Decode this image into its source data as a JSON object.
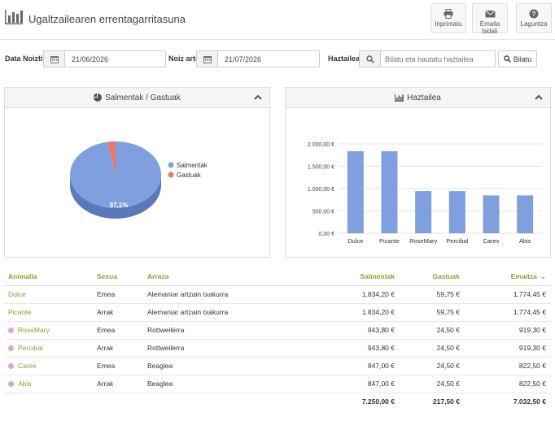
{
  "header": {
    "title": "Ugaltzailearen errentagarritasuna",
    "buttons": [
      {
        "label": "Inprimatu",
        "icon": "printer-icon"
      },
      {
        "label": "Emaila bidali",
        "icon": "envelope-icon"
      },
      {
        "label": "Laguntza",
        "icon": "help-icon"
      }
    ]
  },
  "filters": {
    "date_from_label": "Data Noiztik",
    "date_from_value": "21/06/2026",
    "date_to_label": "Noiz arte",
    "date_to_value": "21/07/2026",
    "breeder_label": "Haztailea:",
    "breeder_placeholder": "Bilatu eta hautatu haztailea",
    "search_button": "Bilatu"
  },
  "pie_panel": {
    "title": "Salmentak / Gastuak",
    "legend": [
      "Salmentak",
      "Gastuak"
    ],
    "colors": [
      "#7f9fdf",
      "#e8786c"
    ],
    "slice_label": "97,1%"
  },
  "bar_panel": {
    "title": "Haztailea"
  },
  "chart_data": [
    {
      "type": "pie",
      "labels": [
        "Salmentak",
        "Gastuak"
      ],
      "values": [
        97.1,
        2.9
      ],
      "data_labels": [
        "97,1%",
        ""
      ],
      "legend": "right"
    },
    {
      "type": "bar",
      "categories": [
        "Dulce",
        "Picante",
        "RoseMary",
        "Percibal",
        "Carex",
        "Abis"
      ],
      "values": [
        1834.2,
        1834.2,
        943.8,
        943.8,
        847.0,
        847.0
      ],
      "ylim": [
        0,
        2000
      ],
      "yticks": [
        "0,00 €",
        "500,00 €",
        "1.000,00 €",
        "1.500,00 €",
        "2.000,00 €"
      ],
      "grid": true,
      "color": "#7f9fdf"
    }
  ],
  "table": {
    "headers": [
      "Animalia",
      "Sexua",
      "Arraza",
      "Salmentak",
      "Gastuak",
      "Emaitza"
    ],
    "rows": [
      {
        "name": "Dulce",
        "dot": false,
        "sex": "Emea",
        "breed": "Alemaniar artzain txakurra",
        "sales": "1.834,20 €",
        "costs": "59,75 €",
        "result": "1.774,45 €"
      },
      {
        "name": "Picante",
        "dot": false,
        "sex": "Arrak",
        "breed": "Alemaniar artzain txakurra",
        "sales": "1.834,20 €",
        "costs": "59,75 €",
        "result": "1.774,45 €"
      },
      {
        "name": "RoseMary",
        "dot": true,
        "sex": "Emea",
        "breed": "Rottweilerra",
        "sales": "943,80 €",
        "costs": "24,50 €",
        "result": "919,30 €"
      },
      {
        "name": "Percibal",
        "dot": true,
        "sex": "Arrak",
        "breed": "Rottweilerra",
        "sales": "943,80 €",
        "costs": "24,50 €",
        "result": "919,30 €"
      },
      {
        "name": "Carex",
        "dot": true,
        "sex": "Emea",
        "breed": "Beaglea",
        "sales": "847,00 €",
        "costs": "24,50 €",
        "result": "822,50 €"
      },
      {
        "name": "Abis",
        "dot": true,
        "sex": "Arrak",
        "breed": "Beaglea",
        "sales": "847,00 €",
        "costs": "24,50 €",
        "result": "822,50 €"
      }
    ],
    "totals": {
      "sales": "7.250,00 €",
      "costs": "217,50 €",
      "result": "7.032,50 €"
    }
  }
}
